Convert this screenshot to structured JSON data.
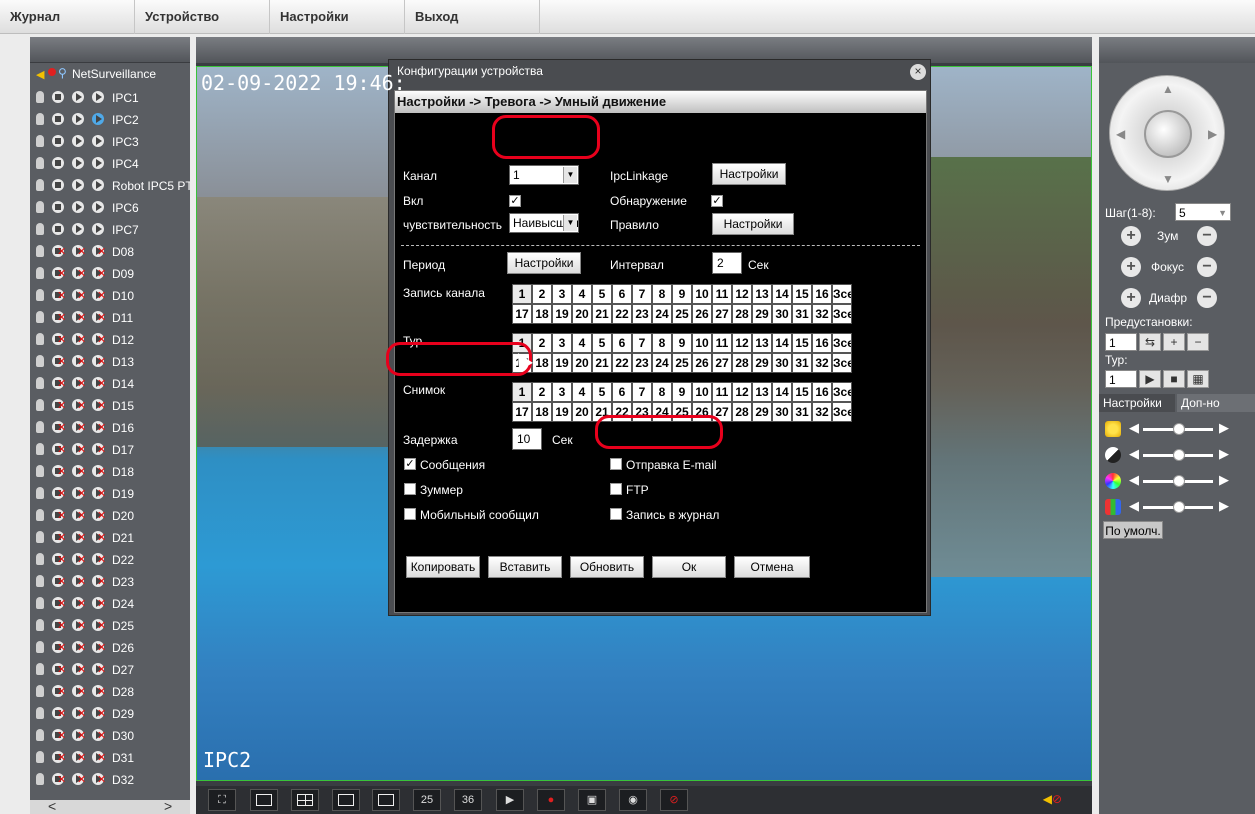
{
  "menu": [
    "Журнал",
    "Устройство",
    "Настройки",
    "Выход"
  ],
  "tree": {
    "root": "NetSurveillance",
    "channels": [
      "IPC1",
      "IPC2",
      "IPC3",
      "IPC4",
      "Robot IPC5 PT",
      "IPC6",
      "IPC7",
      "D08",
      "D09",
      "D10",
      "D11",
      "D12",
      "D13",
      "D14",
      "D15",
      "D16",
      "D17",
      "D18",
      "D19",
      "D20",
      "D21",
      "D22",
      "D23",
      "D24",
      "D25",
      "D26",
      "D27",
      "D28",
      "D29",
      "D30",
      "D31",
      "D32"
    ]
  },
  "scroll": {
    "left": "<",
    "right": ">"
  },
  "video": {
    "timestamp": "02-09-2022 19:46:",
    "camera": "IPC2"
  },
  "layouts": [
    "",
    "",
    "",
    "",
    "",
    "25",
    "36",
    "",
    "",
    "",
    "",
    ""
  ],
  "ptz": {
    "step_label": "Шаг(1-8):",
    "step_value": "5",
    "zoom": "Зум",
    "focus": "Фокус",
    "iris": "Диафр",
    "presets_label": "Предустановки:",
    "preset_value": "1",
    "tour_label": "Тур:",
    "tour_value": "1",
    "minus": "−",
    "plus": "+"
  },
  "right_tabs": {
    "settings": "Настройки",
    "more": "Доп-но"
  },
  "defaults_btn": "По умолч.",
  "dialog": {
    "title": "Конфигурации устройства",
    "close": "×",
    "breadcrumb": "Настройки -> Тревога -> Умный движение",
    "channel_label": "Канал",
    "channel_value": "1",
    "ipclinkage_label": "IpcLinkage",
    "settings_btn": "Настройки",
    "enable_label": "Вкл",
    "detect_label": "Обнаружение",
    "sensitivity_label": "чувствительность",
    "sensitivity_value": "Наивысшая",
    "rule_label": "Правило",
    "period_label": "Период",
    "interval_label": "Интервал",
    "interval_value": "2",
    "sec": "Сек",
    "record_label": "Запись канала",
    "tour_label": "Тур",
    "snapshot_label": "Снимок",
    "delay_label": "Задержка",
    "delay_value": "10",
    "messages_label": "Сообщения",
    "email_label": "Отправка E-mail",
    "buzzer_label": "Зуммер",
    "ftp_label": "FTP",
    "mobile_label": "Мобильный сообщил",
    "log_label": "Запись в журнал",
    "check": "✓",
    "buttons": [
      "Копировать",
      "Вставить",
      "Обновить",
      "Ок",
      "Отмена"
    ]
  },
  "grid_row1": [
    "1",
    "2",
    "3",
    "4",
    "5",
    "6",
    "7",
    "8",
    "9",
    "10",
    "11",
    "12",
    "13",
    "14",
    "15",
    "16",
    "Зсе"
  ],
  "grid_row2": [
    "17",
    "18",
    "19",
    "20",
    "21",
    "22",
    "23",
    "24",
    "25",
    "26",
    "27",
    "28",
    "29",
    "30",
    "31",
    "32",
    "Зсе"
  ]
}
